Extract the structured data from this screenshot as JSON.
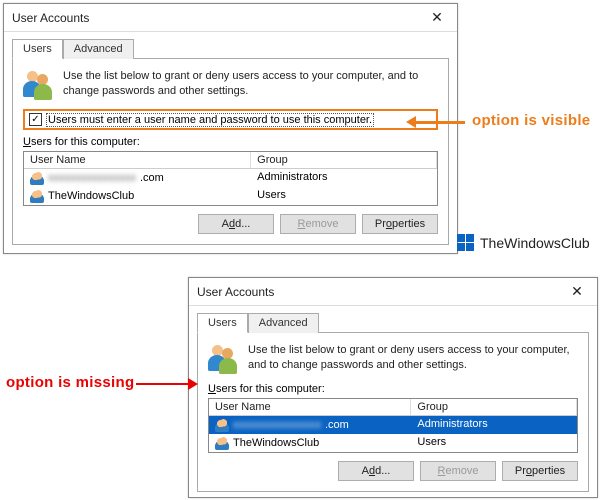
{
  "annotations": {
    "visible_text": "option is visible",
    "missing_text": "option is missing"
  },
  "watermark": {
    "text": "TheWindowsClub"
  },
  "dialog_top": {
    "title": "User Accounts",
    "tab_users": "Users",
    "tab_advanced": "Advanced",
    "info": "Use the list below to grant or deny users access to your computer, and to change passwords and other settings.",
    "checkbox_label": "Users must enter a user name and password to use this computer.",
    "section_label": "Users for this computer:",
    "col_user": "User Name",
    "col_group": "Group",
    "row1_user_suffix": ".com",
    "row1_group": "Administrators",
    "row2_user": "TheWindowsClub",
    "row2_group": "Users",
    "btn_add": "Add...",
    "btn_remove": "Remove",
    "btn_props": "Properties"
  },
  "dialog_bottom": {
    "title": "User Accounts",
    "tab_users": "Users",
    "tab_advanced": "Advanced",
    "info": "Use the list below to grant or deny users access to your computer, and to change passwords and other settings.",
    "section_label": "Users for this computer:",
    "col_user": "User Name",
    "col_group": "Group",
    "row1_user_suffix": ".com",
    "row1_group": "Administrators",
    "row2_user": "TheWindowsClub",
    "row2_group": "Users",
    "btn_add": "Add...",
    "btn_remove": "Remove",
    "btn_props": "Properties"
  }
}
